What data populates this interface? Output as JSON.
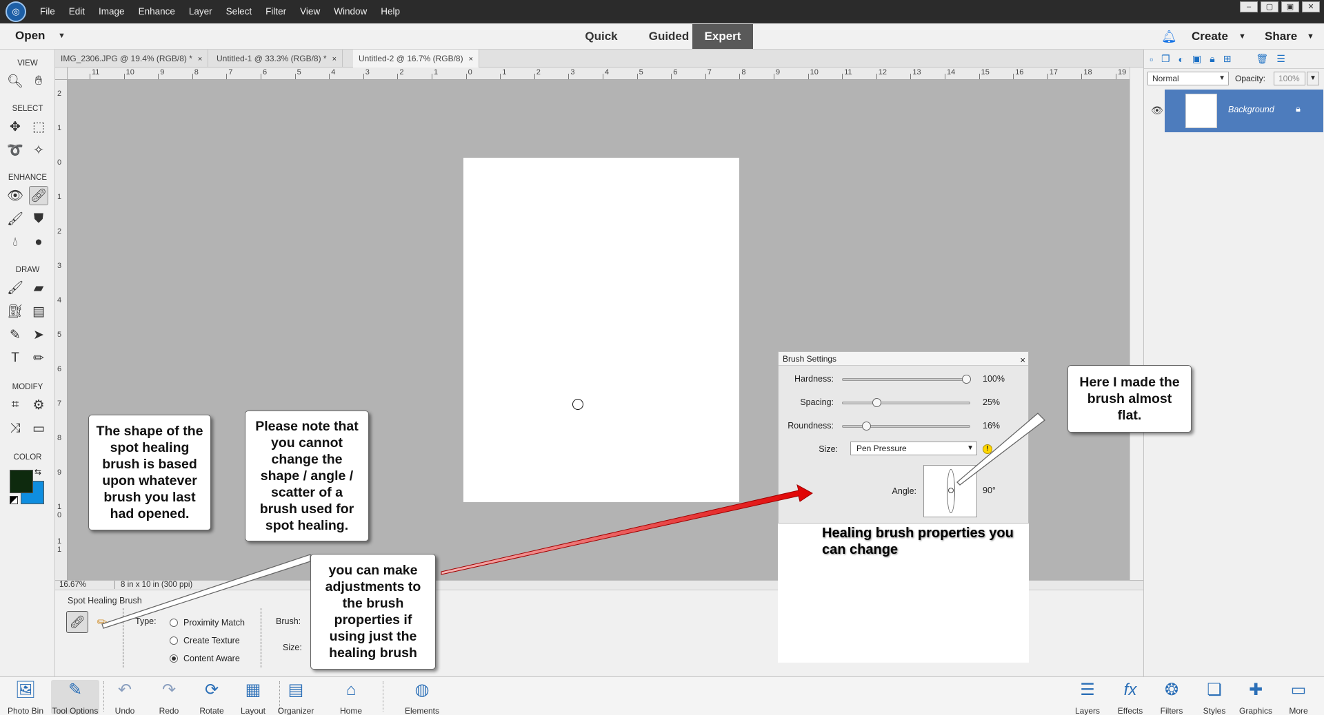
{
  "menu": [
    "File",
    "Edit",
    "Image",
    "Enhance",
    "Layer",
    "Select",
    "Filter",
    "View",
    "Window",
    "Help"
  ],
  "modebar": {
    "open_label": "Open",
    "modes": [
      "Quick",
      "Guided",
      "Expert"
    ],
    "active_mode": "Expert",
    "create_label": "Create",
    "share_label": "Share"
  },
  "document_tabs": [
    {
      "label": "IMG_2306.JPG @ 19.4% (RGB/8) *",
      "close": "×"
    },
    {
      "label": "Untitled-1 @ 33.3% (RGB/8) *",
      "close": "×"
    },
    {
      "label": "Untitled-2 @ 16.7% (RGB/8)",
      "close": "×",
      "active": true
    }
  ],
  "toolbox": {
    "view": "VIEW",
    "select": "SELECT",
    "enhance": "ENHANCE",
    "draw": "DRAW",
    "modify": "MODIFY",
    "color": "COLOR",
    "foreground_color": "#0e2a0e",
    "background_color": "#0f8ee0"
  },
  "ruler": {
    "h_labels": [
      "11",
      "10",
      "9",
      "8",
      "7",
      "6",
      "5",
      "4",
      "3",
      "2",
      "1",
      "0",
      "1",
      "2",
      "3",
      "4",
      "5",
      "6",
      "7",
      "8",
      "9",
      "10",
      "11",
      "12",
      "13",
      "14",
      "15",
      "16",
      "17",
      "18",
      "19"
    ],
    "v_labels": [
      "2",
      "1",
      "0",
      "1",
      "2",
      "3",
      "4",
      "5",
      "6",
      "7",
      "8",
      "9",
      "1 0",
      "1 1"
    ]
  },
  "status": {
    "zoom": "16.67%",
    "doc_size": "8 in x 10 in (300 ppi)"
  },
  "tool_options": {
    "title": "Spot Healing Brush",
    "type_label": "Type:",
    "types": [
      {
        "label": "Proximity Match",
        "checked": false
      },
      {
        "label": "Create Texture",
        "checked": false
      },
      {
        "label": "Content Aware",
        "checked": true
      }
    ],
    "brush_label": "Brush:",
    "size_label": "Size:"
  },
  "layers": {
    "blend_mode": "Normal",
    "opacity_label": "Opacity:",
    "opacity_value": "100%",
    "layer_name": "Background"
  },
  "bottombar": [
    {
      "label": "Photo Bin",
      "icon": "photo-bin-icon"
    },
    {
      "label": "Tool Options",
      "icon": "tool-options-icon"
    },
    {
      "label": "Undo",
      "icon": "undo-icon"
    },
    {
      "label": "Redo",
      "icon": "redo-icon"
    },
    {
      "label": "Rotate",
      "icon": "rotate-icon"
    },
    {
      "label": "Layout",
      "icon": "layout-icon"
    },
    {
      "label": "Organizer",
      "icon": "organizer-icon"
    },
    {
      "label": "Home Screen",
      "icon": "home-icon"
    },
    {
      "label": "Elements Web",
      "icon": "globe-icon"
    },
    {
      "label": "Layers",
      "icon": "layers-icon"
    },
    {
      "label": "Effects",
      "icon": "effects-icon"
    },
    {
      "label": "Filters",
      "icon": "filters-icon"
    },
    {
      "label": "Styles",
      "icon": "styles-icon"
    },
    {
      "label": "Graphics",
      "icon": "graphics-icon"
    },
    {
      "label": "More",
      "icon": "more-icon"
    }
  ],
  "brush_settings": {
    "title": "Brush Settings",
    "close": "×",
    "hardness_label": "Hardness:",
    "hardness": 100,
    "hardness_text": "100%",
    "spacing_label": "Spacing:",
    "spacing": 25,
    "spacing_text": "25%",
    "roundness_label": "Roundness:",
    "roundness": 16,
    "roundness_text": "16%",
    "size_label": "Size:",
    "size_value": "Pen Pressure",
    "angle_label": "Angle:",
    "angle_text": "90°"
  },
  "callouts": {
    "shape_note": "The shape of the spot healing brush is based upon whatever brush you last had opened.",
    "cannot_change_note": "Please note that you cannot change the shape / angle / scatter of a brush used for spot healing.",
    "healing_brush_note": "you can make adjustments to the brush properties if using just the healing brush",
    "flat_note": "Here I made the brush almost flat.",
    "healing_properties": "Healing brush properties you can change"
  },
  "window_controls": [
    "–",
    "▢",
    "▣",
    "✕"
  ]
}
